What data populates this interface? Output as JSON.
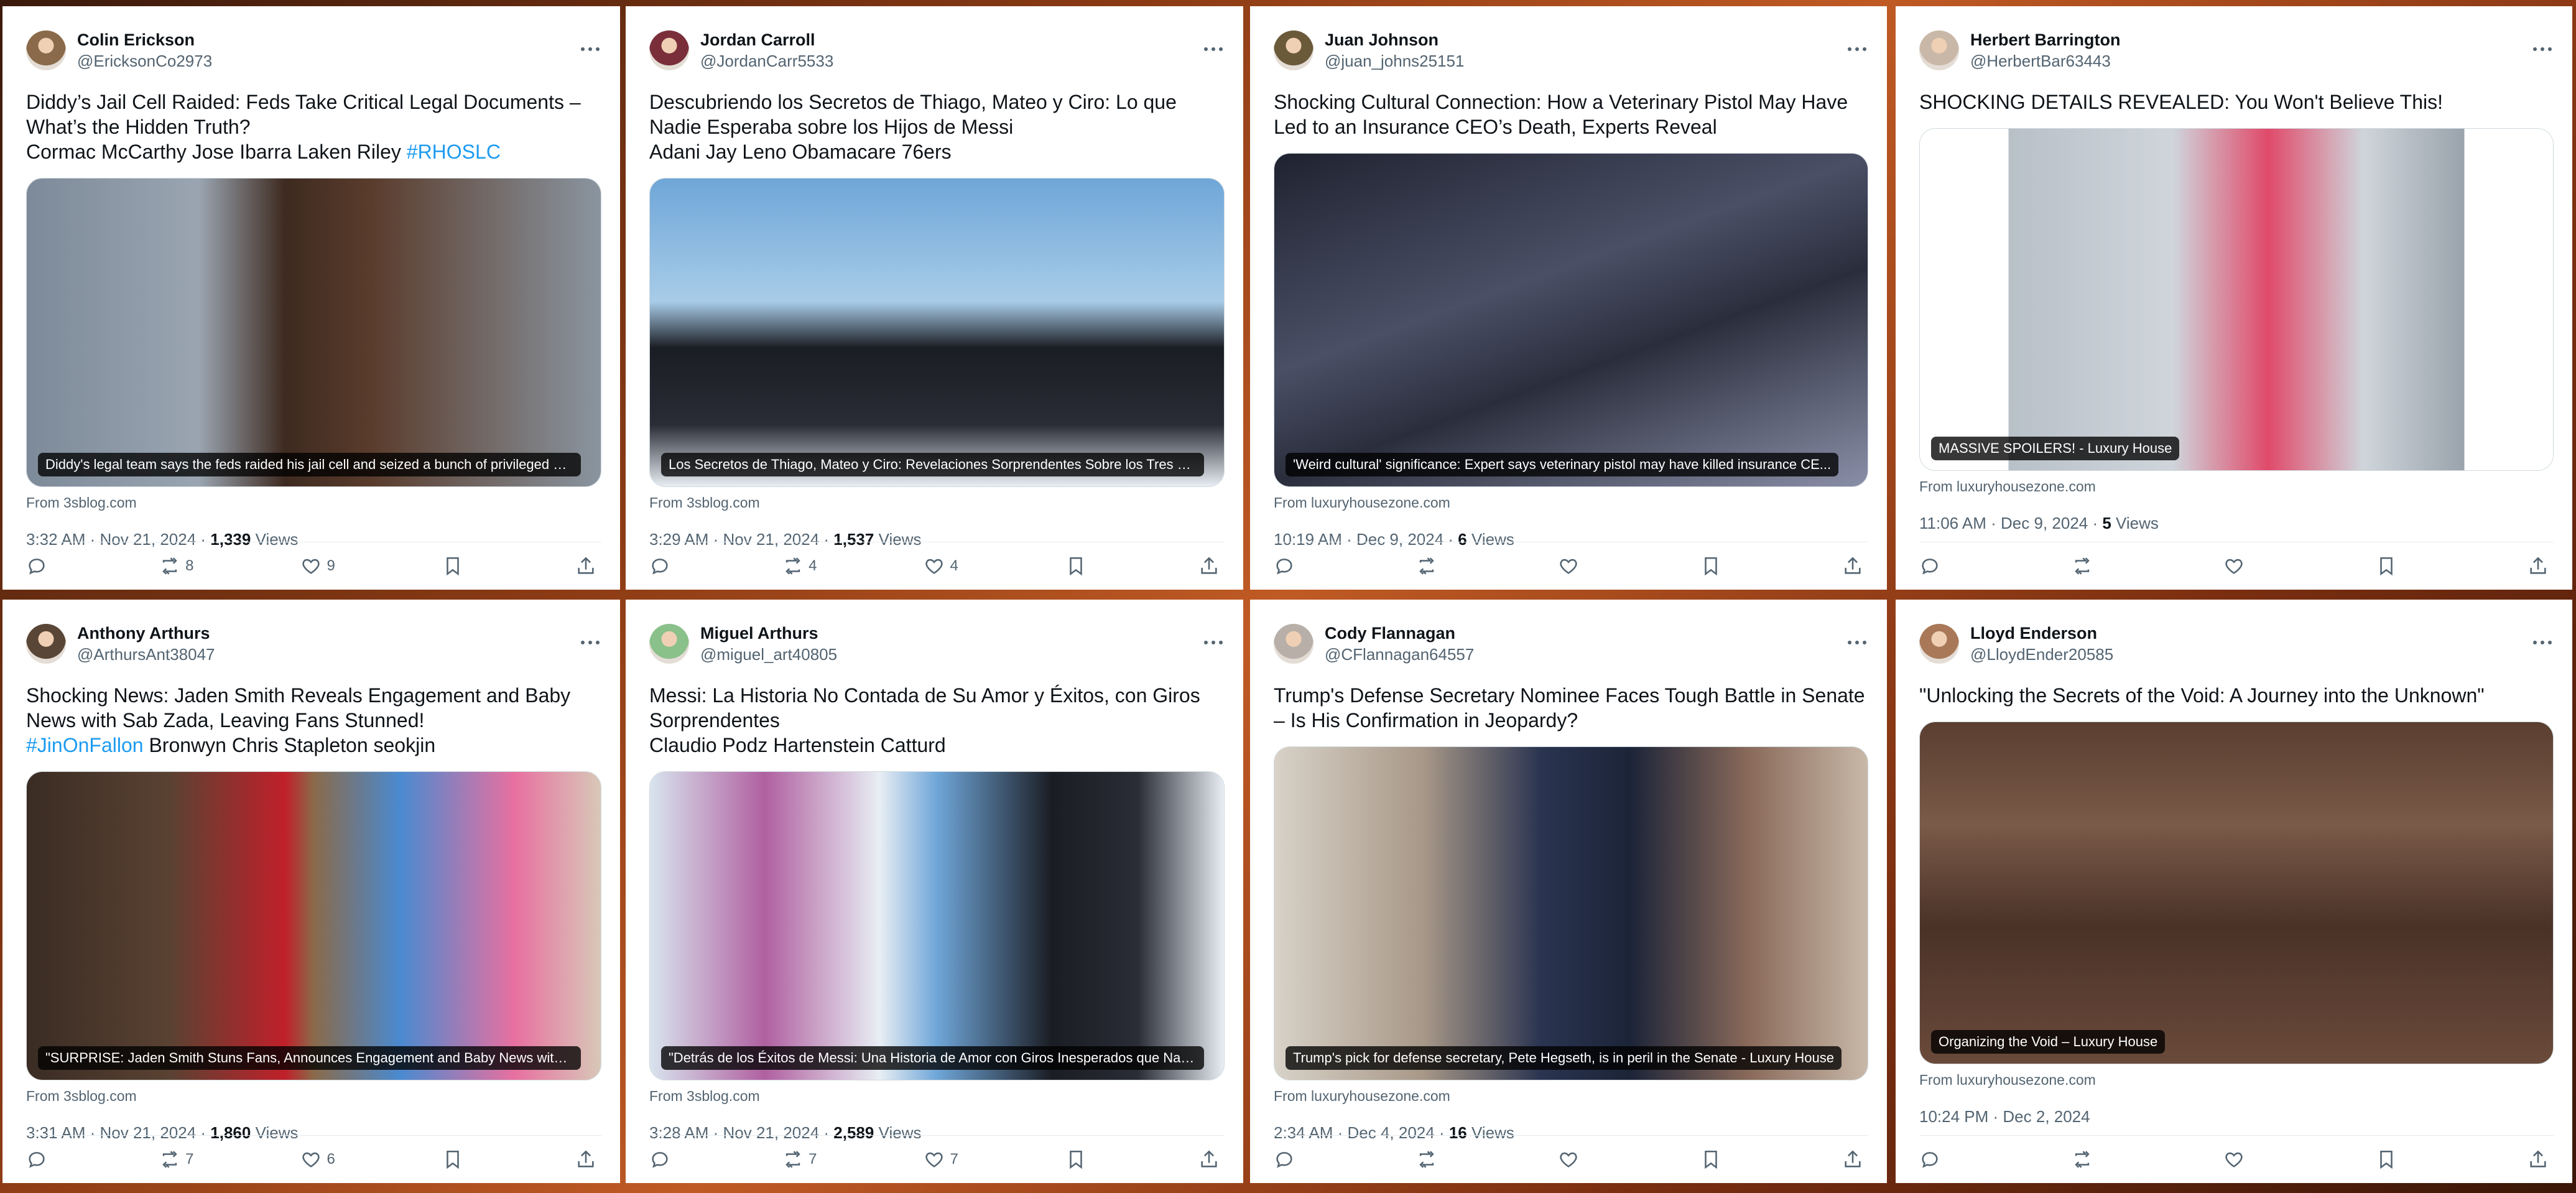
{
  "tweets": [
    {
      "name": "Colin Erickson",
      "handle": "@EricksonCo2973",
      "text": "Diddy’s Jail Cell Raided: Feds Take Critical Legal Documents – What’s the Hidden Truth?\nCormac McCarthy Jose Ibarra Laken Riley ",
      "hashtag": "#RHOSLC",
      "caption": "Diddy's legal team says the feds raided his jail cell and seized a bunch of privileged ma...",
      "source": "From 3sblog.com",
      "time": "3:32 AM · Nov 21, 2024 · ",
      "views": "1,339",
      "views_label": " Views",
      "replies": "",
      "retweets": "8",
      "likes": "9",
      "avatar_color": "#8a6a4a",
      "photo": "linear-gradient(90deg,#7d8a99 0%,#9aa5b1 30%,#3e2a20 45%,#5a3c2c 60%,#8a95a0 100%)"
    },
    {
      "name": "Jordan Carroll",
      "handle": "@JordanCarr5533",
      "text": "Descubriendo los Secretos de Thiago, Mateo y Ciro: Lo que Nadie Esperaba sobre los Hijos de Messi\nAdani Jay Leno Obamacare 76ers",
      "hashtag": "",
      "caption": "Los Secretos de Thiago, Mateo y Ciro: Revelaciones Sorprendentes Sobre los Tres Hijo...",
      "source": "From 3sblog.com",
      "time": "3:29 AM · Nov 21, 2024 · ",
      "views": "1,537",
      "views_label": " Views",
      "replies": "",
      "retweets": "4",
      "likes": "4",
      "avatar_color": "#7a2e3a",
      "photo": "linear-gradient(180deg,#6fa6d8 0%,#a8cce8 40%,#1b1d24 55%,#2a2c36 80%,#e8eef4 100%)"
    },
    {
      "name": "Juan Johnson",
      "handle": "@juan_johns25151",
      "text": "Shocking Cultural Connection: How a Veterinary Pistol May Have Led to an Insurance CEO’s Death, Experts Reveal",
      "hashtag": "",
      "caption": "'Weird cultural' significance: Expert says veterinary pistol may have killed insurance CE...",
      "source": "From luxuryhousezone.com",
      "time": "10:19 AM · Dec 9, 2024 · ",
      "views": "6",
      "views_label": " Views",
      "replies": "",
      "retweets": "",
      "likes": "",
      "avatar_color": "#6a5a3a",
      "photo": "linear-gradient(160deg,#1f2330 0%,#4a4f66 40%,#2a2e3c 60%,#8a8fa8 100%)"
    },
    {
      "name": "Herbert Barrington",
      "handle": "@HerbertBar63443",
      "text": "SHOCKING DETAILS REVEALED: You Won't Believe This!",
      "hashtag": "",
      "caption": "MASSIVE SPOILERS! - Luxury House",
      "source": "From luxuryhousezone.com",
      "time": "11:06 AM · Dec 9, 2024 · ",
      "views": "5",
      "views_label": " Views",
      "replies": "",
      "retweets": "",
      "likes": "",
      "avatar_color": "#c9b8a8",
      "photo": "linear-gradient(90deg,#ffffff 0%,#ffffff 14%,#b8c0c8 14%,#cfd5db 40%,#e04a6a 55%,#cfd5db 70%,#9aa3ac 86%,#ffffff 86%,#ffffff 100%)"
    },
    {
      "name": "Anthony Arthurs",
      "handle": "@ArthursAnt38047",
      "text": "Shocking News: Jaden Smith Reveals Engagement and Baby News with Sab Zada, Leaving Fans Stunned!\n",
      "hashtag": "#JinOnFallon",
      "text_after": " Bronwyn Chris Stapleton seokjin",
      "caption": "\"SURPRISE: Jaden Smith Stuns Fans, Announces Engagement and Baby News with Sa...",
      "source": "From 3sblog.com",
      "time": "3:31 AM · Nov 21, 2024 · ",
      "views": "1,860",
      "views_label": " Views",
      "replies": "",
      "retweets": "7",
      "likes": "6",
      "avatar_color": "#5a4636",
      "photo": "linear-gradient(90deg,#3a2c24 0%,#5a4232 25%,#c0202a 45%,#8a6a4a 50%,#4a8ad0 65%,#e870a0 85%,#d8c8b8 100%)"
    },
    {
      "name": "Miguel Arthurs",
      "handle": "@miguel_art40805",
      "text": "Messi: La Historia No Contada de Su Amor y Éxitos, con Giros Sorprendentes\nClaudio Podz Hartenstein Catturd",
      "hashtag": "",
      "caption": "\"Detrás de los Éxitos de Messi: Una Historia de Amor con Giros Inesperados que Nadie...",
      "source": "From 3sblog.com",
      "time": "3:28 AM · Nov 21, 2024 · ",
      "views": "2,589",
      "views_label": " Views",
      "replies": "",
      "retweets": "7",
      "likes": "7",
      "avatar_color": "#8ac08a",
      "photo": "linear-gradient(90deg,#d8e4ee 0%,#b060a0 20%,#e8eef4 40%,#6fa6d8 50%,#1b1d24 70%,#2a2c36 85%,#e8eef4 100%)"
    },
    {
      "name": "Cody Flannagan",
      "handle": "@CFlannagan64557",
      "text": "Trump's Defense Secretary Nominee Faces Tough Battle in Senate – Is His Confirmation in Jeopardy?",
      "hashtag": "",
      "caption": "Trump's pick for defense secretary, Pete Hegseth, is in peril in the Senate - Luxury House",
      "source": "From luxuryhousezone.com",
      "time": "2:34 AM · Dec 4, 2024 · ",
      "views": "16",
      "views_label": " Views",
      "replies": "",
      "retweets": "",
      "likes": "",
      "avatar_color": "#b8b0a8",
      "photo": "linear-gradient(90deg,#d8d2c8 0%,#a89888 25%,#2a3450 45%,#1c2438 60%,#8a6a5a 80%,#c8b8a8 100%)"
    },
    {
      "name": "Lloyd Enderson",
      "handle": "@LloydEnder20585",
      "text": "\"Unlocking the Secrets of the Void: A Journey into the Unknown\"",
      "hashtag": "",
      "caption": "Organizing the Void – Luxury House",
      "source": "From luxuryhousezone.com",
      "time": "10:24 PM · Dec 2, 2024",
      "views": "",
      "views_label": "",
      "replies": "",
      "retweets": "",
      "likes": "",
      "avatar_color": "#a87858",
      "photo": "linear-gradient(180deg,#5a3e30 0%,#7a5a48 30%,#4a3228 60%,#6a4a3a 100%)"
    }
  ]
}
